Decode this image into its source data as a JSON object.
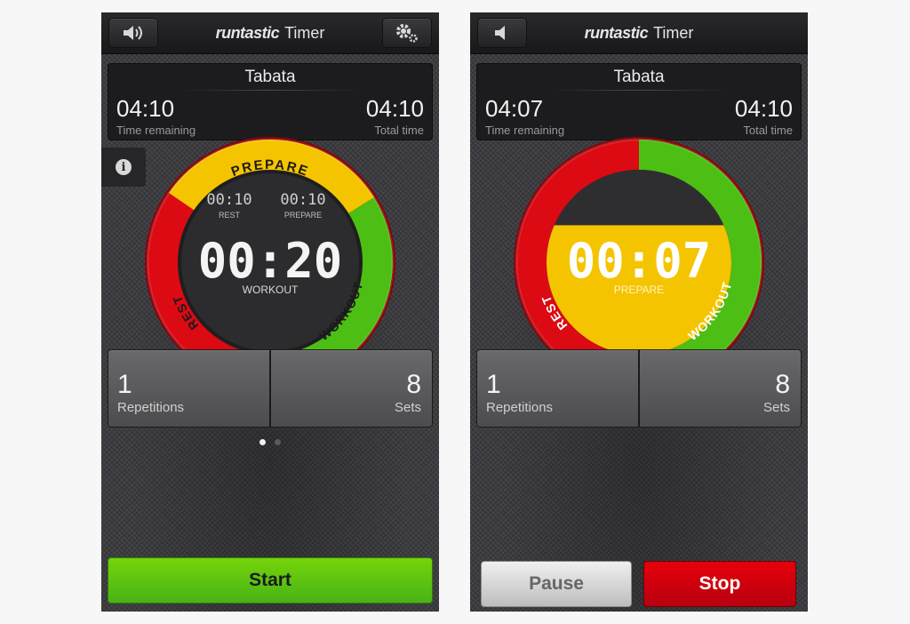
{
  "screens": [
    {
      "header": {
        "brand": "runtastic",
        "title": "Timer",
        "sound_icon": "speaker-loud-icon",
        "settings_icon": "gears-icon"
      },
      "panel": {
        "title": "Tabata",
        "time_remaining": "04:10",
        "time_remaining_label": "Time remaining",
        "total_time": "04:10",
        "total_time_label": "Total time"
      },
      "info_icon": "info-icon",
      "ring": {
        "segment_labels": {
          "prepare": "PREPARE",
          "rest": "REST",
          "workout": "WORKOUT"
        },
        "small_timers": [
          {
            "value": "00:10",
            "label": "REST"
          },
          {
            "value": "00:10",
            "label": "PREPARE"
          }
        ],
        "main_timer": "00:20",
        "main_label": "WORKOUT"
      },
      "tiles": {
        "repetitions_value": "1",
        "repetitions_label": "Repetitions",
        "sets_value": "8",
        "sets_label": "Sets"
      },
      "pager": {
        "pages": 2,
        "active": 1
      },
      "buttons": {
        "start": "Start"
      }
    },
    {
      "header": {
        "brand": "runtastic",
        "title": "Timer",
        "sound_icon": "speaker-muted-icon"
      },
      "panel": {
        "title": "Tabata",
        "time_remaining": "04:07",
        "time_remaining_label": "Time remaining",
        "total_time": "04:10",
        "total_time_label": "Total time"
      },
      "ring": {
        "segment_labels": {
          "rest": "REST",
          "workout": "WORKOUT"
        },
        "main_timer": "00:07",
        "main_label": "PREPARE",
        "prepare_fill_fraction": 0.7
      },
      "tiles": {
        "repetitions_value": "1",
        "repetitions_label": "Repetitions",
        "sets_value": "8",
        "sets_label": "Sets"
      },
      "buttons": {
        "pause": "Pause",
        "stop": "Stop"
      }
    }
  ],
  "colors": {
    "prepare": "#f5c400",
    "rest": "#dc0a12",
    "workout": "#4cbe14",
    "ring_border": "#8a0008",
    "start": "#5cc410",
    "stop": "#d8000c"
  }
}
